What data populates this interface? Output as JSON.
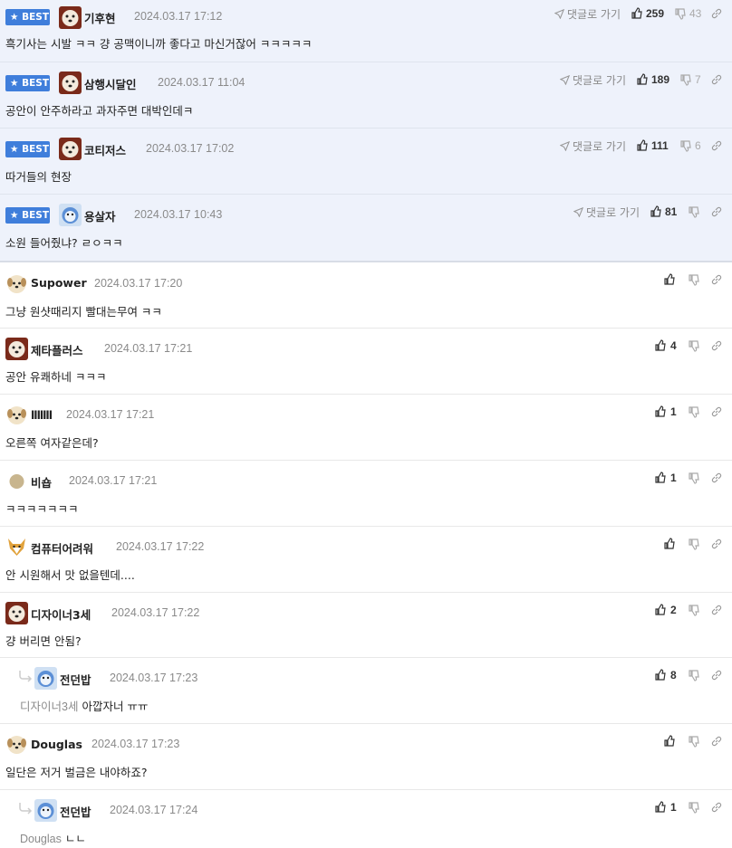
{
  "labels": {
    "best": "BEST",
    "goto_reply": "댓글로 가기"
  },
  "colors": {
    "best_badge": "#3f7edb",
    "best_bg": "#eef2fb",
    "meta_gray": "#8a8a8a"
  },
  "best_comments": [
    {
      "author": "기후현",
      "date": "2024.03.17 17:12",
      "text": "흑기사는 시발 ㅋㅋ 걍 공맥이니까 좋다고 마신거잖어 ㅋㅋㅋㅋㅋ",
      "likes": "259",
      "dislikes": "43",
      "avatar_icon": "puppy-red-avatar"
    },
    {
      "author": "삼행시달인",
      "date": "2024.03.17 11:04",
      "text": "공안이 안주하라고 과자주면 대박인데ㅋ",
      "likes": "189",
      "dislikes": "7",
      "avatar_icon": "puppy-red-avatar"
    },
    {
      "author": "코티저스",
      "date": "2024.03.17 17:02",
      "text": "따거들의 현장",
      "likes": "111",
      "dislikes": "6",
      "avatar_icon": "puppy-red-avatar"
    },
    {
      "author": "용살자",
      "date": "2024.03.17 10:43",
      "text": "소원 들어줬냐? ㄹㅇㅋㅋ",
      "likes": "81",
      "dislikes": "",
      "avatar_icon": "bear-blue-avatar"
    }
  ],
  "comments": [
    {
      "author": "Supower",
      "date": "2024.03.17 17:20",
      "text": "그냥 원샷때리지 빨대는무여 ㅋㅋ",
      "likes": "",
      "avatar_icon": "puppy-avatar"
    },
    {
      "author": "제타플러스",
      "date": "2024.03.17 17:21",
      "text": "공안 유쾌하네 ㅋㅋㅋ",
      "likes": "4",
      "avatar_icon": "puppy-red-avatar"
    },
    {
      "author": "lllllll",
      "date": "2024.03.17 17:21",
      "text": "오른쪽 여자같은데?",
      "likes": "1",
      "avatar_icon": "puppy-avatar"
    },
    {
      "author": "비숍",
      "date": "2024.03.17 17:21",
      "text": "ㅋㅋㅋㅋㅋㅋㅋ",
      "likes": "1",
      "avatar_icon": "dot-avatar"
    },
    {
      "author": "컴퓨터어려워",
      "date": "2024.03.17 17:22",
      "text": "안 시원해서 맛 없을텐데....",
      "likes": "",
      "avatar_icon": "fox-avatar"
    },
    {
      "author": "디자이너3세",
      "date": "2024.03.17 17:22",
      "text": "걍 버리면 안됨?",
      "likes": "2",
      "avatar_icon": "puppy-red-avatar"
    },
    {
      "author": "전던밥",
      "date": "2024.03.17 17:23",
      "mention": "디자이너3세",
      "text": "아깝자너 ㅠㅠ",
      "likes": "8",
      "avatar_icon": "bear-blue-avatar",
      "reply": true
    },
    {
      "author": "Douglas",
      "date": "2024.03.17 17:23",
      "text": "일단은 저거 벌금은 내야하죠?",
      "likes": "",
      "avatar_icon": "puppy-avatar"
    },
    {
      "author": "전던밥",
      "date": "2024.03.17 17:24",
      "mention": "Douglas",
      "text": "ㄴㄴ",
      "likes": "1",
      "avatar_icon": "bear-blue-avatar",
      "reply": true
    }
  ]
}
